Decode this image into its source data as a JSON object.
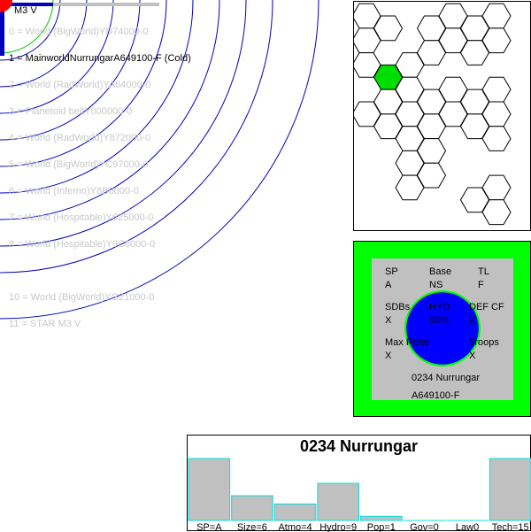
{
  "star": {
    "label": "M3 V"
  },
  "orbits": [
    {
      "text": "0 = World  (BigWorld)YD74000-0",
      "selected": false
    },
    {
      "text": "1 = MainworldNurrungarA649100-F (Cold)",
      "selected": true
    },
    {
      "text": "2 = World  (RadWorld)YA64000-0",
      "selected": false
    },
    {
      "text": "3 = Planetoid beltY000000-0",
      "selected": false
    },
    {
      "text": "4 = World  (RadWorld)Y872000-0",
      "selected": false
    },
    {
      "text": "5 = World  (BigWorld)YC97000-0",
      "selected": false
    },
    {
      "text": "6 = World  (Inferno)Y8B0000-0",
      "selected": false
    },
    {
      "text": "7 = World  (Hospitable)Y625000-0",
      "selected": false
    },
    {
      "text": "8 = World  (Hospitable)Y9C6000-0",
      "selected": false
    },
    {
      "text": "10 = World  (BigWorld)YG21000-0",
      "selected": false
    },
    {
      "text": "11 = STAR M3 V",
      "selected": false
    }
  ],
  "colors": {
    "orbit": "#0000c0",
    "star": "#ff0000",
    "inner_orbit": "#00c000",
    "highlight_hex": "#00dd00",
    "ocean": "#0000ff",
    "panel_green": "#00ff00",
    "bar_fill": "#c0c0c0",
    "bar_stroke": "#00e0e0"
  },
  "planet": {
    "sp_label": "SP",
    "sp_value": "A",
    "base_label": "Base",
    "base_value": "NS",
    "tl_label": "TL",
    "tl_value": "F",
    "sdb_label": "SDBs",
    "sdb_value": "X",
    "hyd_label": "HYD",
    "hyd_value": "90%",
    "def_label": "DEF CF",
    "def_value": "X",
    "maxrons_label": "Max Rons",
    "maxrons_value": "X",
    "troops_label": "Troops",
    "troops_value": "X",
    "name": "0234 Nurrungar",
    "uwp": "A649100-F",
    "hydro_fraction": 0.9
  },
  "chart_data": {
    "type": "bar",
    "title": "0234 Nurrungar",
    "categories": [
      "SP=A",
      "Size=6",
      "Atmo=4",
      "Hydro=9",
      "Pop=1",
      "Gov=0",
      "Law0",
      "Tech=15"
    ],
    "values": [
      15,
      6,
      4,
      9,
      1,
      0,
      0,
      15
    ],
    "ylim": [
      0,
      15
    ]
  }
}
